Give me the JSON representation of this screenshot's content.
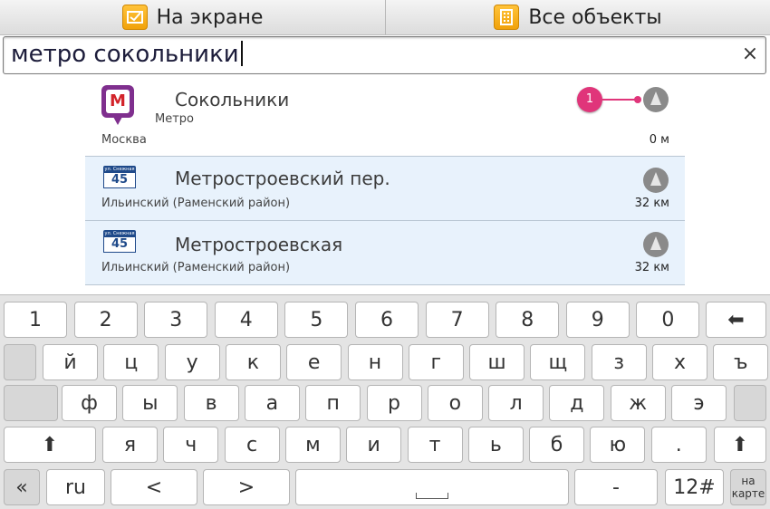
{
  "tabs": {
    "on_screen": "На экране",
    "all_objects": "Все объекты"
  },
  "search": {
    "value": "метро сокольники",
    "clear_glyph": "×"
  },
  "results": [
    {
      "title": "Сокольники",
      "category": "Метро",
      "city": "Москва",
      "distance": "0 м",
      "icon": "metro-icon"
    },
    {
      "title": "Метростроевский пер.",
      "city": "Ильинский (Раменский район)",
      "distance": "32 км",
      "icon": "street-sign-icon",
      "sign_top": "ул. Снежная",
      "sign_number": "45"
    },
    {
      "title": "Метростроевская",
      "city": "Ильинский (Раменский район)",
      "distance": "32 км",
      "icon": "street-sign-icon",
      "sign_top": "ул. Снежная",
      "sign_number": "45"
    }
  ],
  "metro_letter": "М",
  "badge": "1",
  "keyboard": {
    "row1": [
      "1",
      "2",
      "3",
      "4",
      "5",
      "6",
      "7",
      "8",
      "9",
      "0"
    ],
    "backspace": "⬅",
    "row2": [
      "й",
      "ц",
      "у",
      "к",
      "е",
      "н",
      "г",
      "ш",
      "щ",
      "з",
      "х",
      "ъ"
    ],
    "row3": [
      "ф",
      "ы",
      "в",
      "а",
      "п",
      "р",
      "о",
      "л",
      "д",
      "ж",
      "э"
    ],
    "shift": "⬆",
    "row4": [
      "я",
      "ч",
      "с",
      "м",
      "и",
      "т",
      "ь",
      "б",
      "ю",
      "."
    ],
    "bottom": {
      "back": "«",
      "lang": "ru",
      "left": "<",
      "right": ">",
      "dash": "-",
      "sym": "12#",
      "map_line1": "на",
      "map_line2": "карте"
    }
  },
  "colors": {
    "accent": "#e0357a",
    "metro": "#7f2f8e",
    "row_alt": "#e8f2fc"
  }
}
